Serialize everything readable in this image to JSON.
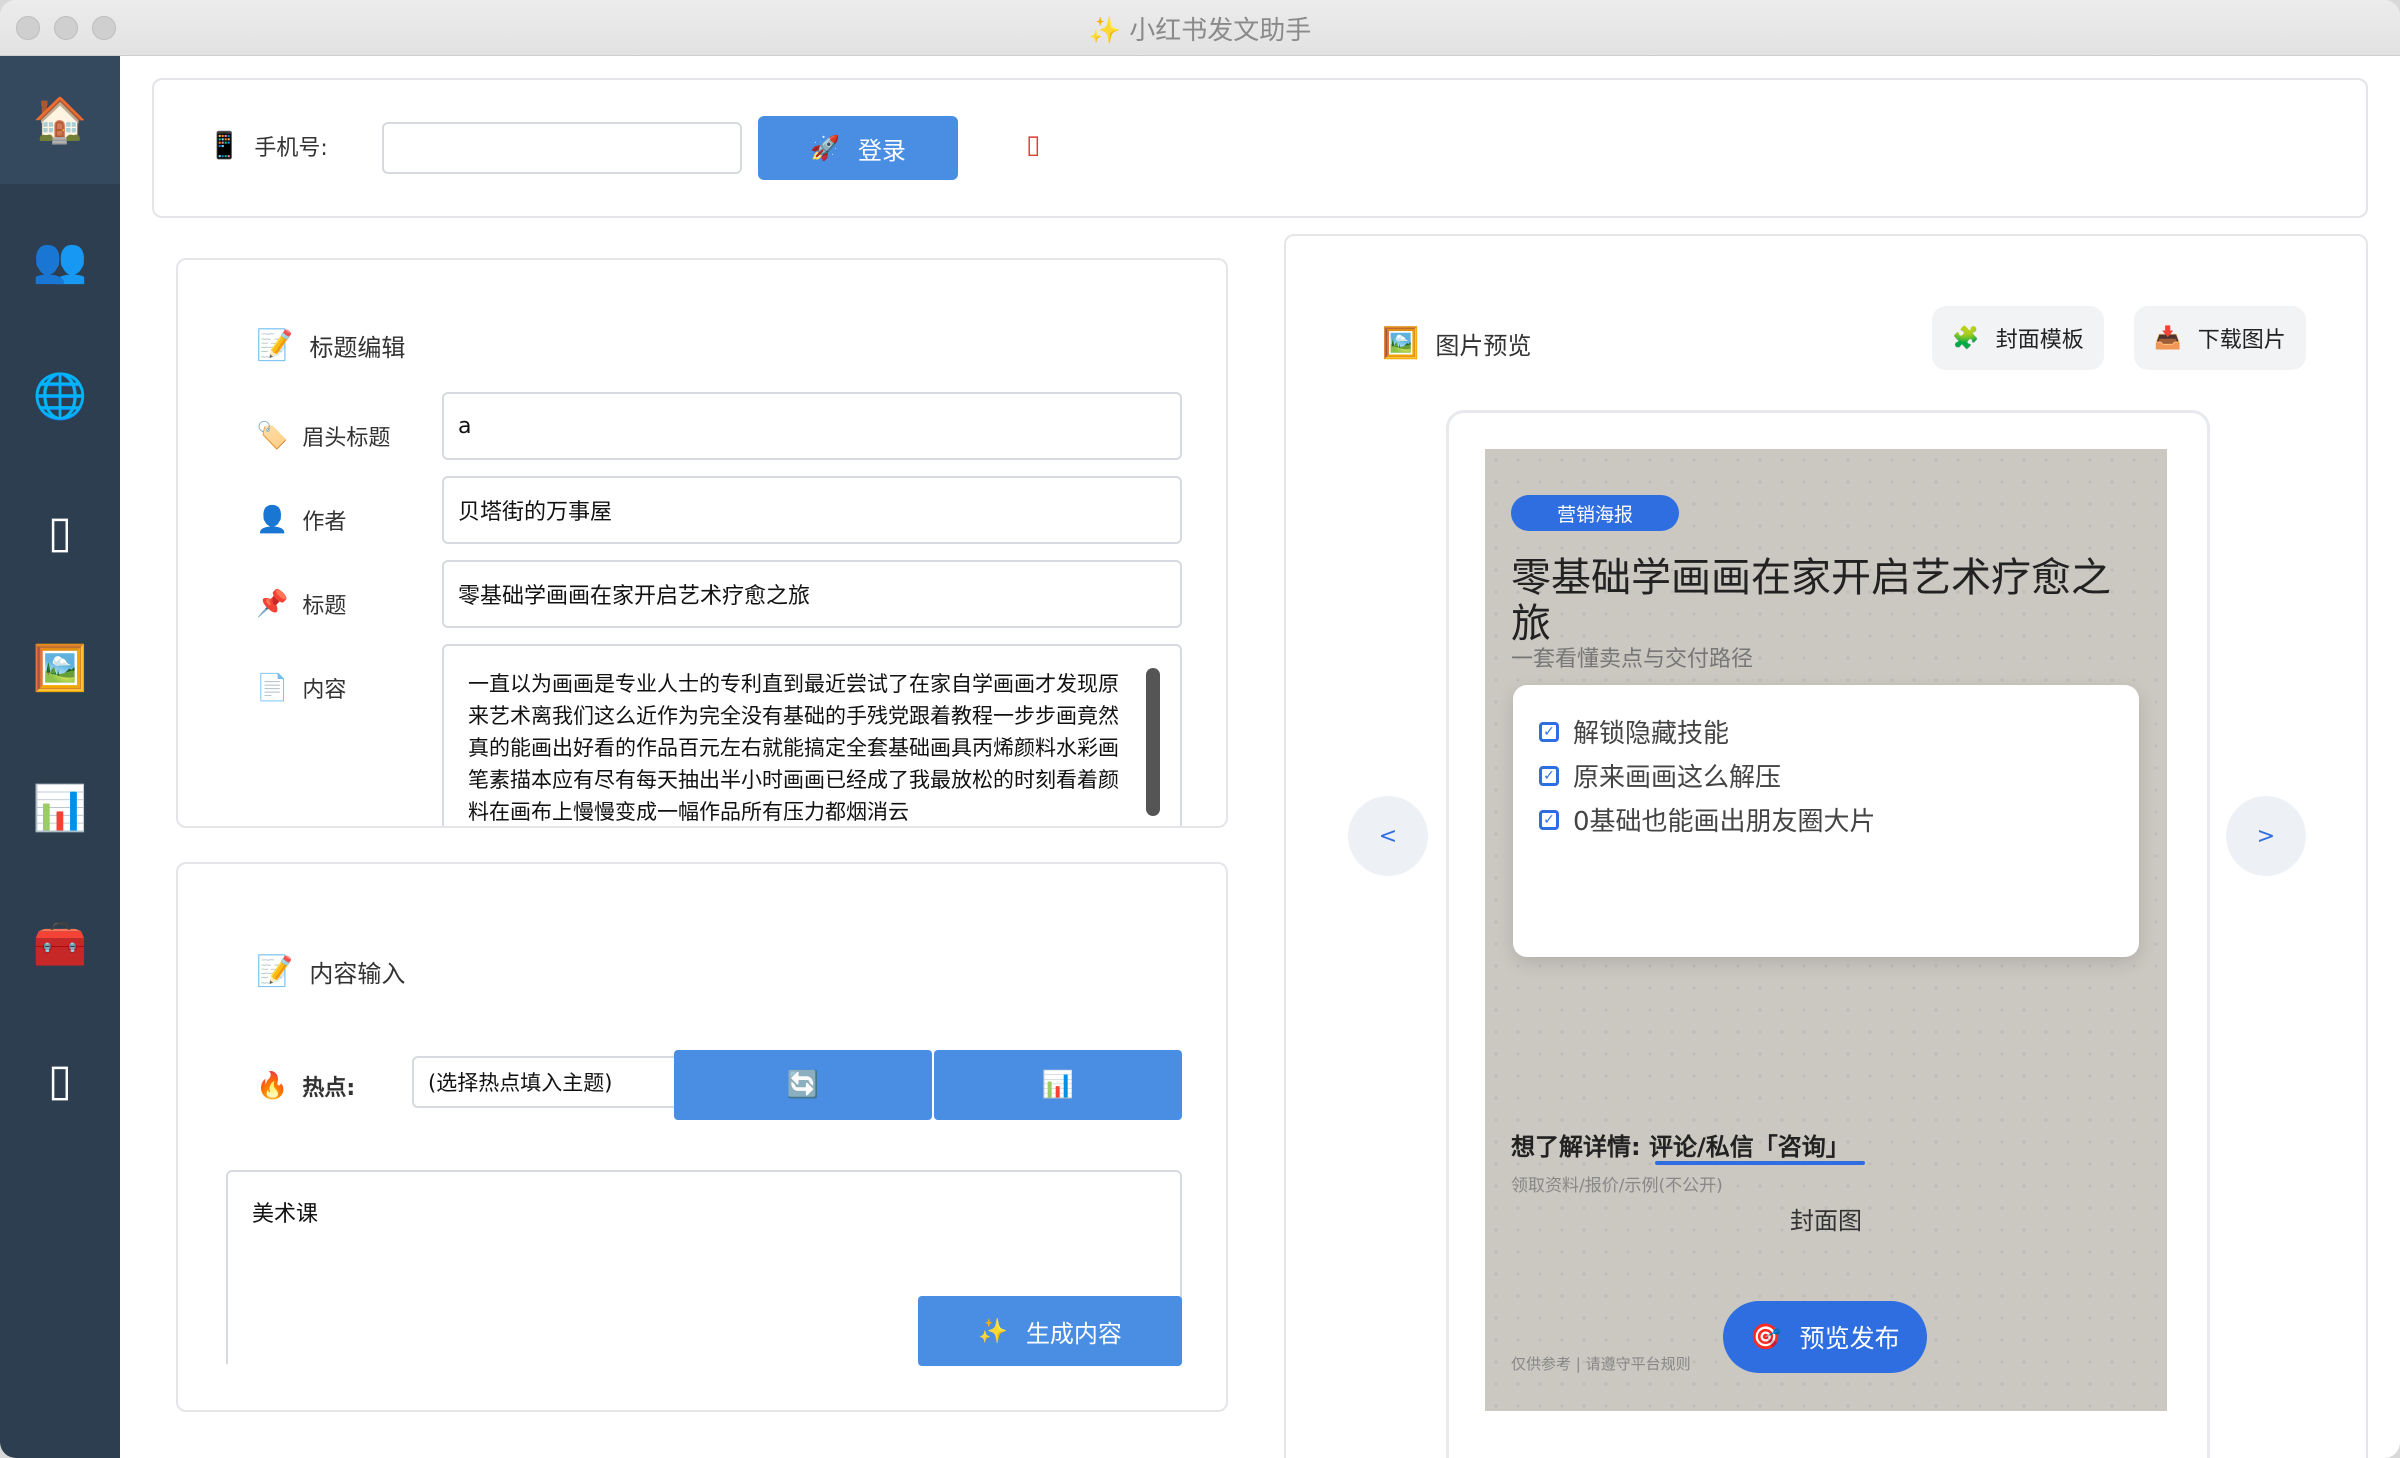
{
  "window": {
    "title": "✨ 小红书发文助手"
  },
  "sidebar": {
    "items": [
      {
        "icon": "house-icon",
        "glyph": "🏠",
        "active": true
      },
      {
        "icon": "users-icon",
        "glyph": "👥"
      },
      {
        "icon": "globe-icon",
        "glyph": "🌐"
      },
      {
        "icon": "phone-icon",
        "glyph": "▯"
      },
      {
        "icon": "picture-icon",
        "glyph": "🖼️"
      },
      {
        "icon": "bar-chart-icon",
        "glyph": "📊"
      },
      {
        "icon": "toolbox-icon",
        "glyph": "🧰"
      },
      {
        "icon": "device-icon",
        "glyph": "▯"
      }
    ]
  },
  "login": {
    "phone_label": "手机号:",
    "phone_value": "",
    "login_button": "登录",
    "status_glyph": "▯"
  },
  "title_editor": {
    "heading": "标题编辑",
    "header_title_label": "眉头标题",
    "header_title_value": "a",
    "author_label": "作者",
    "author_value": "贝塔街的万事屋",
    "title_label": "标题",
    "title_value": "零基础学画画在家开启艺术疗愈之旅",
    "content_label": "内容",
    "content_value": "一直以为画画是专业人士的专利直到最近尝试了在家自学画画才发现原来艺术离我们这么近作为完全没有基础的手残党跟着教程一步步画竟然真的能画出好看的作品百元左右就能搞定全套基础画具丙烯颜料水彩画笔素描本应有尽有每天抽出半小时画画已经成了我最放松的时刻看着颜料在画布上慢慢变成一幅作品所有压力都烟消云"
  },
  "content_input": {
    "heading": "内容输入",
    "hot_label": "热点:",
    "hot_select": "(选择热点填入主题)",
    "refresh_glyph": "🔄",
    "chart_glyph": "📊",
    "topic_value": "美术课",
    "generate_button": "生成内容"
  },
  "preview": {
    "heading": "图片预览",
    "template_button": "封面模板",
    "download_button": "下载图片",
    "prev": "<",
    "next": ">",
    "poster": {
      "badge": "营销海报",
      "title": "零基础学画画在家开启艺术疗愈之旅",
      "subtitle": "一套看懂卖点与交付路径",
      "points": [
        "解锁隐藏技能",
        "原来画画这么解压",
        "0基础也能画出朋友圈大片"
      ],
      "cta_prefix": "想了解详情:",
      "cta_action": "评论/私信「咨询」",
      "cta_note": "领取资料/报价/示例(不公开)",
      "caption": "封面图",
      "footer_note": "仅供参考 | 请遵守平台规则",
      "publish_button": "预览发布"
    }
  },
  "colors": {
    "sidebar": "#2c3e50",
    "accent": "#4a8ee4",
    "poster_accent": "#2f6ee0"
  }
}
